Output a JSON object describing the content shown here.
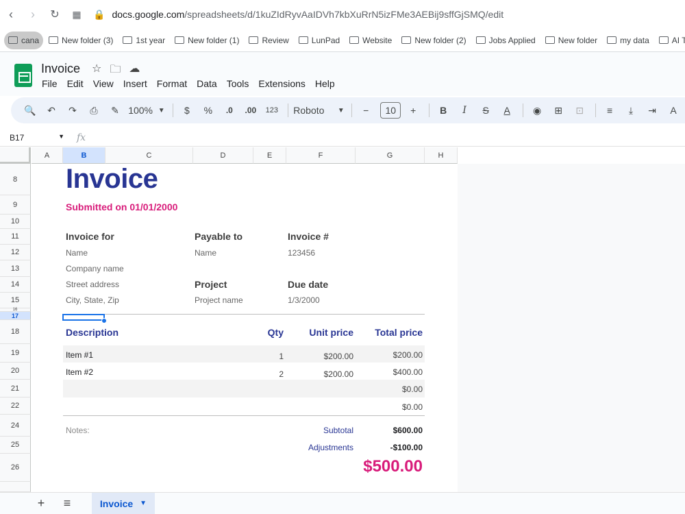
{
  "browser": {
    "url_host": "docs.google.com",
    "url_path": "/spreadsheets/d/1kuZIdRyvAaIDVh7kbXuRrN5izFMe3AEBij9sffGjSMQ/edit",
    "bookmarks": [
      "cana",
      "New folder (3)",
      "1st year",
      "New folder (1)",
      "Review",
      "LunPad",
      "Website",
      "New folder (2)",
      "Jobs Applied",
      "New folder",
      "my data",
      "AI Tools"
    ]
  },
  "app": {
    "title": "Invoice",
    "menu": [
      "File",
      "Edit",
      "View",
      "Insert",
      "Format",
      "Data",
      "Tools",
      "Extensions",
      "Help"
    ]
  },
  "toolbar": {
    "zoom": "100%",
    "currency": "$",
    "percent": "%",
    "dec_decrease": ".0",
    "dec_increase": ".00",
    "format_number": "123",
    "font": "Roboto",
    "font_size": "10",
    "bold": "B",
    "italic": "I"
  },
  "formula_bar": {
    "name_box": "B17",
    "fx": "fx"
  },
  "columns": [
    "A",
    "B",
    "C",
    "D",
    "E",
    "F",
    "G",
    "H"
  ],
  "rows": [
    "8",
    "9",
    "10",
    "11",
    "12",
    "13",
    "14",
    "15",
    "16",
    "17",
    "18",
    "19",
    "20",
    "21",
    "22",
    "24",
    "25",
    "26"
  ],
  "invoice": {
    "title": "Invoice",
    "submitted": "Submitted on 01/01/2000",
    "invoice_for_label": "Invoice for",
    "payable_to_label": "Payable to",
    "invoice_num_label": "Invoice #",
    "name1": "Name",
    "name2": "Name",
    "invoice_num": "123456",
    "company": "Company name",
    "project_label": "Project",
    "due_label": "Due date",
    "street": "Street address",
    "city": "City, State, Zip",
    "project_name": "Project name",
    "due_date": "1/3/2000",
    "col_desc": "Description",
    "col_qty": "Qty",
    "col_unit": "Unit price",
    "col_total": "Total price",
    "items": [
      {
        "desc": "Item #1",
        "qty": "1",
        "unit": "$200.00",
        "total": "$200.00"
      },
      {
        "desc": "Item #2",
        "qty": "2",
        "unit": "$200.00",
        "total": "$400.00"
      },
      {
        "desc": "",
        "qty": "",
        "unit": "",
        "total": "$0.00"
      },
      {
        "desc": "",
        "qty": "",
        "unit": "",
        "total": "$0.00"
      }
    ],
    "notes": "Notes:",
    "subtotal_label": "Subtotal",
    "subtotal": "$600.00",
    "adjust_label": "Adjustments",
    "adjust": "-$100.00",
    "grand_total": "$500.00"
  },
  "sheet_tab": "Invoice"
}
